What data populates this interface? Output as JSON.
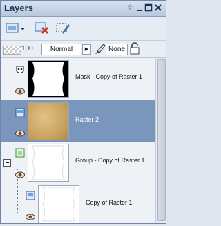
{
  "panel": {
    "title": "Layers",
    "title_buttons": [
      "pin-icon",
      "minimize-icon",
      "maximize-icon",
      "close-icon"
    ]
  },
  "toolbar": {
    "new_layer_icon": "new-raster-layer-icon",
    "delete_icon": "delete-layer-icon",
    "edit_icon": "edit-selection-icon"
  },
  "properties": {
    "opacity": "100",
    "blend_mode": "Normal",
    "lock_mode": "None"
  },
  "layers": [
    {
      "name": "Mask - Copy of Raster 1",
      "type": "mask",
      "selected": false,
      "visible": true
    },
    {
      "name": "Raster 2",
      "type": "raster",
      "selected": true,
      "visible": true
    },
    {
      "name": "Group - Copy of Raster 1",
      "type": "group",
      "selected": false,
      "visible": true
    },
    {
      "name": "Copy of Raster 1",
      "type": "raster",
      "selected": false,
      "visible": true
    }
  ],
  "colors": {
    "selection": "#7b96bd",
    "title_text": "#1d2f4d"
  }
}
